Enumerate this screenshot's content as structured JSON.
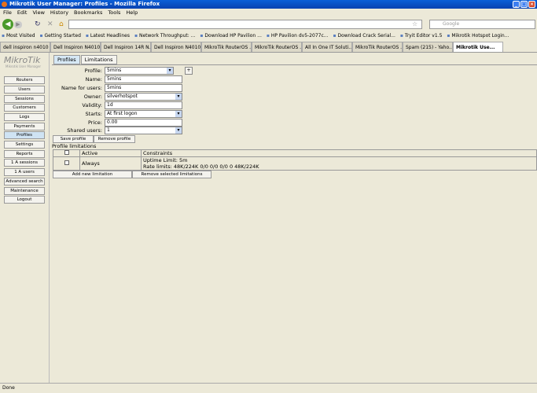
{
  "window": {
    "title": "Mikrotik User Manager: Profiles - Mozilla Firefox"
  },
  "menu": [
    "File",
    "Edit",
    "View",
    "History",
    "Bookmarks",
    "Tools",
    "Help"
  ],
  "search": {
    "placeholder": "Google"
  },
  "bookmarks": [
    "Most Visited",
    "Getting Started",
    "Latest Headlines",
    "Network Throughput: ...",
    "Download HP Pavilion ...",
    "HP Pavilion dv5-2077c...",
    "Download Crack Serial...",
    "Tryit Editor v1.5",
    "Mikrotik Hotspot Login..."
  ],
  "tabs": [
    {
      "label": "dell inspiron n4010 ..."
    },
    {
      "label": "Dell Inspiron N4010..."
    },
    {
      "label": "Dell Inspiron 14R N..."
    },
    {
      "label": "Dell Inspiron N4010..."
    },
    {
      "label": "MikroTik RouterOS ..."
    },
    {
      "label": "MikroTik RouterOS ..."
    },
    {
      "label": "All In One IT Soluti..."
    },
    {
      "label": "MikroTik RouterOS ..."
    },
    {
      "label": "Spam (215) - Yaho..."
    },
    {
      "label": "Mikrotik Use...",
      "active": true
    }
  ],
  "logo": {
    "text": "MikroTik",
    "sub": "Mikrotik User Manager"
  },
  "sidebar": [
    "Routers",
    "Users",
    "Sessions",
    "Customers",
    "Logs",
    "Payments",
    "Profiles",
    "Settings",
    "Reports",
    "1 A sessions",
    "1 A users",
    "Advanced search",
    "Maintenance",
    "Logout"
  ],
  "sidebar_selected": "Profiles",
  "page_tabs": [
    "Profiles",
    "Limitations"
  ],
  "form": {
    "profile": {
      "label": "Profile:",
      "value": "5mins"
    },
    "name": {
      "label": "Name:",
      "value": "5mins"
    },
    "name_for_users": {
      "label": "Name for users:",
      "value": "5mins"
    },
    "owner": {
      "label": "Owner:",
      "value": "silverhotspot"
    },
    "validity": {
      "label": "Validity:",
      "value": "1d"
    },
    "starts": {
      "label": "Starts:",
      "value": "At first logon"
    },
    "price": {
      "label": "Price:",
      "value": "0.00"
    },
    "shared_users": {
      "label": "Shared users:",
      "value": "1"
    },
    "plus": "+"
  },
  "buttons": {
    "save": "Save profile",
    "remove": "Remove profile",
    "add_limitation": "Add new limitation",
    "remove_limitations": "Remove selected limitations"
  },
  "limitations": {
    "title": "Profile limitations",
    "headers": [
      "Active",
      "Constraints"
    ],
    "rows": [
      {
        "active": "Always",
        "uptime": "Uptime Limit: 5m",
        "rate": "Rate limits: 48K/224K 0/0 0/0 0/0 0 48K/224K"
      }
    ]
  },
  "status": "Done"
}
